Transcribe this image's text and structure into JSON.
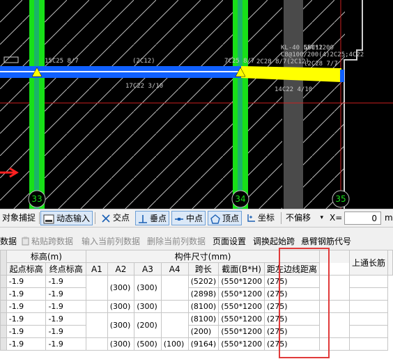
{
  "cad": {
    "axis_labels": [
      "33",
      "34",
      "35"
    ],
    "beam_labels": {
      "left_top": "15C25 8/7",
      "left_mid": "(2C12)",
      "left_bottom": "17C22 3/10",
      "right_top": "7C25 8/7",
      "right_mid_a": "2C28 8/7(2C12)",
      "right_bottom": "14C22 4/10",
      "kl_1": "KL-40 550*1200",
      "kl_2": "C8@100/200(4)2C25;4C22",
      "kl_3": "G6C12",
      "kl_4": "(2C28 7/7"
    },
    "colors": {
      "column": "#18e018",
      "beam": "#1060ff",
      "highlight_beam": "#ffff00",
      "axis": "#cc2020",
      "wall": "#4a4a4a"
    }
  },
  "toolbar1": {
    "snap": "对象捕捉",
    "dynamic_input": "动态输入",
    "intersection": "交点",
    "perpendicular": "垂点",
    "midpoint": "中点",
    "vertex": "顶点",
    "coord": "坐标",
    "offset_select": "不偏移",
    "x_label": "X=",
    "x_value": "0",
    "x_unit": "m"
  },
  "toolbar2": {
    "data": "数据",
    "paste_span": "粘贴跨数据",
    "input_col": "输入当前列数据",
    "delete_col": "删除当前列数据",
    "page_setup": "页面设置",
    "swap_start": "调换起始跨",
    "cantilever_code": "悬臂钢筋代号"
  },
  "grid": {
    "headers": {
      "elevation_group": "标高(m)",
      "start_elev": "起点标高",
      "end_elev": "终点标高",
      "size_group": "构件尺寸(mm)",
      "a1": "A1",
      "a2": "A2",
      "a3": "A3",
      "a4": "A4",
      "span": "跨长",
      "section": "截面(B*H)",
      "left_dist": "距左边线距离",
      "top_rebar": "上通长筋"
    },
    "rows": [
      {
        "start": "-1.9",
        "end": "-1.9",
        "a1": "",
        "a2": "",
        "a3": "",
        "a4": "",
        "span": "(5202)",
        "section": "(550*1200",
        "dist": "(275)"
      },
      {
        "start": "-1.9",
        "end": "-1.9",
        "a1": "",
        "a2": "",
        "a3": "",
        "a4": "",
        "span": "(2898)",
        "section": "(550*1200",
        "dist": "(275)"
      },
      {
        "start": "-1.9",
        "end": "-1.9",
        "a1": "",
        "a2": "(300)",
        "a3": "(300)",
        "a4": "",
        "span": "(8100)",
        "section": "(550*1200",
        "dist": "(275)"
      },
      {
        "start": "-1.9",
        "end": "-1.9",
        "a1": "",
        "a2": "",
        "a3": "",
        "a4": "",
        "span": "(8100)",
        "section": "(550*1200",
        "dist": "(275)"
      },
      {
        "start": "-1.9",
        "end": "-1.9",
        "a1": "",
        "a2": "",
        "a3": "",
        "a4": "",
        "span": "(200)",
        "section": "(550*1200",
        "dist": "(275)"
      },
      {
        "start": "-1.9",
        "end": "-1.9",
        "a1": "",
        "a2": "(300)",
        "a3": "(500)",
        "a4": "(100)",
        "span": "(9164)",
        "section": "(550*1200",
        "dist": "(275)"
      }
    ],
    "merged": {
      "r01_a2": "(300)",
      "r01_a3": "(300)",
      "r34_a2": "(300)",
      "r34_a3": "(200)"
    }
  }
}
